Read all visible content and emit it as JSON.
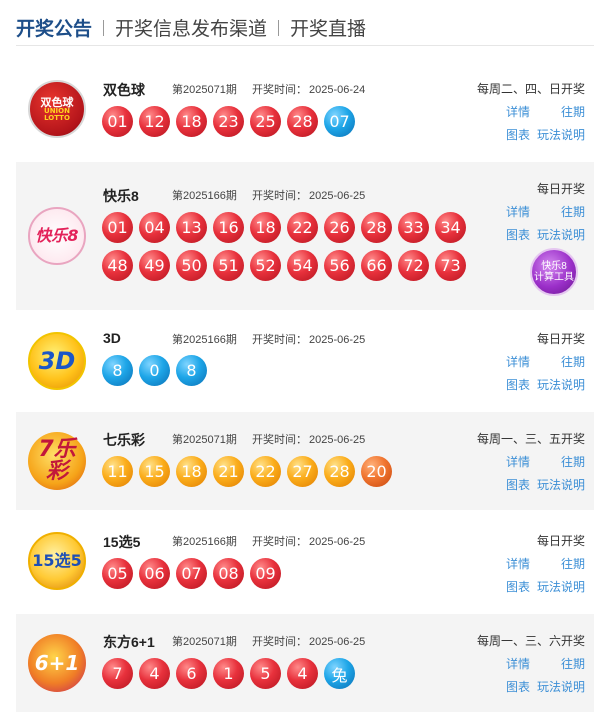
{
  "tabs": [
    {
      "label": "开奖公告"
    },
    {
      "label": "开奖信息发布渠道"
    },
    {
      "label": "开奖直播"
    }
  ],
  "date_label": "开奖时间：",
  "links": {
    "detail": "详情",
    "past": "往期",
    "chart": "图表",
    "rules": "玩法说明"
  },
  "lotteries": [
    {
      "name": "双色球",
      "logo": {
        "icon": "shuangseqiu-logo",
        "line1": "双色球",
        "line2": "UNION LOTTO"
      },
      "issue": "第2025071期",
      "date": "2025-06-24",
      "schedule": "每周二、四、日开奖",
      "balls": [
        {
          "num": "01",
          "color": "red"
        },
        {
          "num": "12",
          "color": "red"
        },
        {
          "num": "18",
          "color": "red"
        },
        {
          "num": "23",
          "color": "red"
        },
        {
          "num": "25",
          "color": "red"
        },
        {
          "num": "28",
          "color": "red"
        },
        {
          "num": "07",
          "color": "blue"
        }
      ]
    },
    {
      "name": "快乐8",
      "logo": {
        "icon": "kuaile8-logo",
        "line1": "快乐8"
      },
      "issue": "第2025166期",
      "date": "2025-06-25",
      "schedule": "每日开奖",
      "calc_tool": {
        "line1": "快乐8",
        "line2": "计算工具"
      },
      "balls": [
        {
          "num": "01",
          "color": "red"
        },
        {
          "num": "04",
          "color": "red"
        },
        {
          "num": "13",
          "color": "red"
        },
        {
          "num": "16",
          "color": "red"
        },
        {
          "num": "18",
          "color": "red"
        },
        {
          "num": "22",
          "color": "red"
        },
        {
          "num": "26",
          "color": "red"
        },
        {
          "num": "28",
          "color": "red"
        },
        {
          "num": "33",
          "color": "red"
        },
        {
          "num": "34",
          "color": "red"
        },
        {
          "num": "48",
          "color": "red"
        },
        {
          "num": "49",
          "color": "red"
        },
        {
          "num": "50",
          "color": "red"
        },
        {
          "num": "51",
          "color": "red"
        },
        {
          "num": "52",
          "color": "red"
        },
        {
          "num": "54",
          "color": "red"
        },
        {
          "num": "56",
          "color": "red"
        },
        {
          "num": "66",
          "color": "red"
        },
        {
          "num": "72",
          "color": "red"
        },
        {
          "num": "73",
          "color": "red"
        }
      ]
    },
    {
      "name": "3D",
      "logo": {
        "icon": "fucai-3d-logo",
        "line1": "3D"
      },
      "issue": "第2025166期",
      "date": "2025-06-25",
      "schedule": "每日开奖",
      "balls": [
        {
          "num": "8",
          "color": "blue"
        },
        {
          "num": "0",
          "color": "blue"
        },
        {
          "num": "8",
          "color": "blue"
        }
      ]
    },
    {
      "name": "七乐彩",
      "logo": {
        "icon": "qilecai-logo",
        "line1": "7乐彩"
      },
      "issue": "第2025071期",
      "date": "2025-06-25",
      "schedule": "每周一、三、五开奖",
      "balls": [
        {
          "num": "11",
          "color": "orange"
        },
        {
          "num": "15",
          "color": "orange"
        },
        {
          "num": "18",
          "color": "orange"
        },
        {
          "num": "21",
          "color": "orange"
        },
        {
          "num": "22",
          "color": "orange"
        },
        {
          "num": "27",
          "color": "orange"
        },
        {
          "num": "28",
          "color": "orange"
        },
        {
          "num": "20",
          "color": "dorange"
        }
      ]
    },
    {
      "name": "15选5",
      "logo": {
        "icon": "15xuan5-logo",
        "line1": "15选5"
      },
      "issue": "第2025166期",
      "date": "2025-06-25",
      "schedule": "每日开奖",
      "balls": [
        {
          "num": "05",
          "color": "red"
        },
        {
          "num": "06",
          "color": "red"
        },
        {
          "num": "07",
          "color": "red"
        },
        {
          "num": "08",
          "color": "red"
        },
        {
          "num": "09",
          "color": "red"
        }
      ]
    },
    {
      "name": "东方6+1",
      "logo": {
        "icon": "dongfang61-logo",
        "line1": "6+1"
      },
      "issue": "第2025071期",
      "date": "2025-06-25",
      "schedule": "每周一、三、六开奖",
      "balls": [
        {
          "num": "7",
          "color": "red"
        },
        {
          "num": "4",
          "color": "red"
        },
        {
          "num": "6",
          "color": "red"
        },
        {
          "num": "1",
          "color": "red"
        },
        {
          "num": "5",
          "color": "red"
        },
        {
          "num": "4",
          "color": "red"
        },
        {
          "num": "兔",
          "color": "blue"
        }
      ]
    }
  ]
}
